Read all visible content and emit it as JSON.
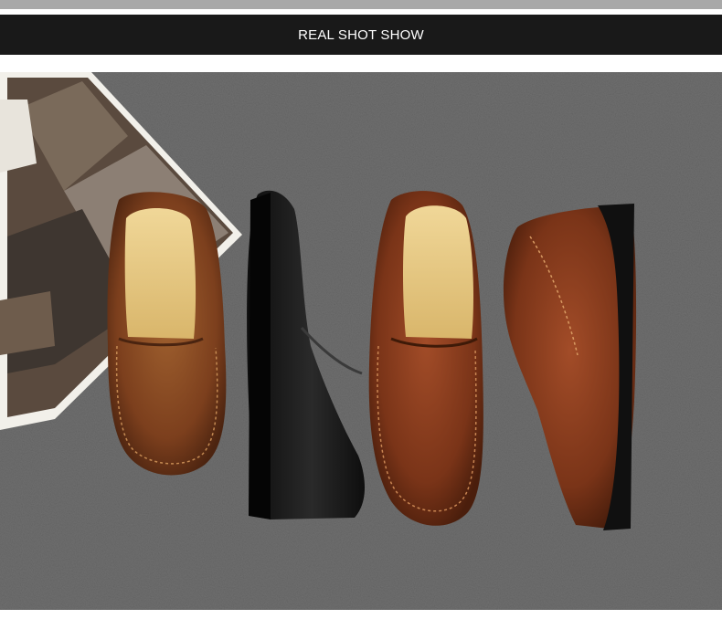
{
  "header": {
    "title": "REAL SHOT SHOW"
  },
  "photo": {
    "subject": "four-loafers-on-carpet-icon",
    "colors": {
      "carpet": "#6f6f6f",
      "brown_shoe": "#8a4a24",
      "black_shoe": "#141414",
      "insole": "#e6c784",
      "magazine_page": "#f2f0ea"
    }
  }
}
